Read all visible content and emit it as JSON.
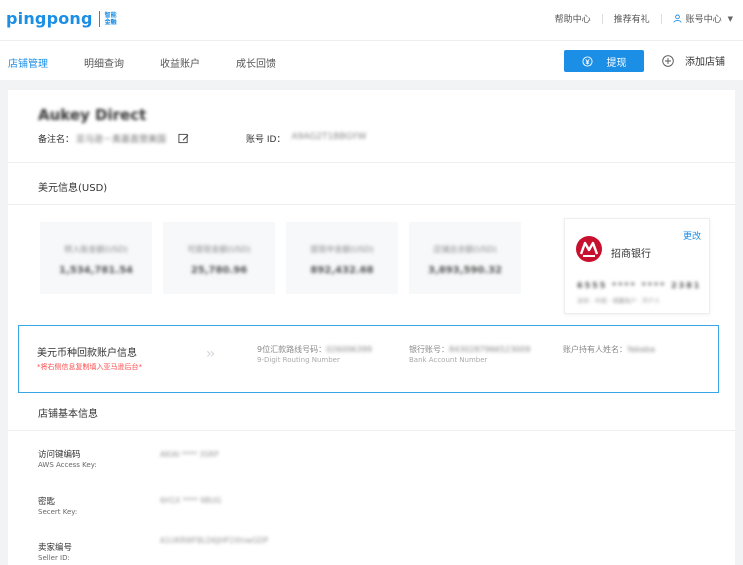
{
  "header": {
    "logo_text": "pingpong",
    "logo_sub": "智能金融",
    "nav": [
      "帮助中心",
      "推荐有礼"
    ],
    "account_label": "账号中心",
    "colors": {
      "brand": "#1b8ee6",
      "warning": "#ff4d4f"
    }
  },
  "tabs": [
    {
      "label": "店铺管理",
      "active": true
    },
    {
      "label": "明细查询",
      "active": false
    },
    {
      "label": "收益账户",
      "active": false
    },
    {
      "label": "成长回馈",
      "active": false
    }
  ],
  "actions": {
    "withdraw": "提现",
    "add_shop": "添加店铺"
  },
  "shop": {
    "name": "Aukey Direct",
    "remark_label": "备注名：",
    "remark_value": "亚马逊－奥基直营美国",
    "account_id_label": "账号 ID：",
    "account_id_value": "A9AG2T1BBGYW"
  },
  "usd": {
    "title": "美元信息(USD)",
    "stats": [
      {
        "label": "转入账金额(USD)",
        "value": "1,534,781.54"
      },
      {
        "label": "可提现金额(USD)",
        "value": "25,780.96"
      },
      {
        "label": "提现中金额(USD)",
        "value": "892,432.68"
      },
      {
        "label": "店铺总余额(USD)",
        "value": "3,893,590.32"
      }
    ],
    "bank": {
      "change": "更改",
      "name": "招商银行",
      "number": "6555 **** **** 2381",
      "sub": "深圳 · 中国 · 储蓄账户 · 开户人"
    }
  },
  "usd_account": {
    "title": "美元币种回款账户信息",
    "warning": "*将右侧信息复制填入亚马逊后台*",
    "routing": {
      "label": "9位汇款路线号码：",
      "value": "026006399",
      "en": "9-Digit Routing Number"
    },
    "bank_account": {
      "label": "银行账号：",
      "value": "8430287966523009",
      "en": "Bank Account Number"
    },
    "holder": {
      "label": "账户持有人姓名：",
      "value": "Yakaba"
    }
  },
  "basic": {
    "title": "店铺基本信息",
    "rows": [
      {
        "label": "访问键编码",
        "en": "AWS Access Key:",
        "value": "AKIAI **** 3SRP"
      },
      {
        "label": "密匙",
        "en": "Secert Key:",
        "value": "6H1X **** 9BUG"
      },
      {
        "label": "卖家编号",
        "en": "Seller ID:",
        "value": "A1UKRWFBLD6JHP2XhiwGDP"
      }
    ]
  }
}
